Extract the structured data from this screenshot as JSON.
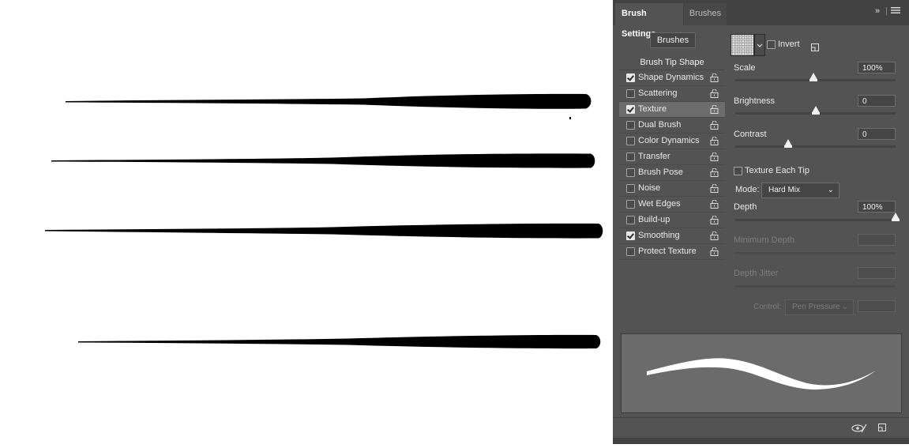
{
  "panel": {
    "tabs": [
      "Brush Settings",
      "Brushes"
    ],
    "brushes_button": "Brushes",
    "list_title": "Brush Tip Shape",
    "options": [
      {
        "label": "Shape Dynamics",
        "checked": true
      },
      {
        "label": "Scattering",
        "checked": false
      },
      {
        "label": "Texture",
        "checked": true,
        "selected": true
      },
      {
        "label": "Dual Brush",
        "checked": false
      },
      {
        "label": "Color Dynamics",
        "checked": false
      },
      {
        "label": "Transfer",
        "checked": false
      },
      {
        "label": "Brush Pose",
        "checked": false
      },
      {
        "label": "Noise",
        "checked": false
      },
      {
        "label": "Wet Edges",
        "checked": false
      },
      {
        "label": "Build-up",
        "checked": false
      },
      {
        "label": "Smoothing",
        "checked": true
      },
      {
        "label": "Protect Texture",
        "checked": false
      }
    ],
    "texture": {
      "invert_label": "Invert",
      "invert_checked": false,
      "scale_label": "Scale",
      "scale_value": "100%",
      "scale_level": 0.49,
      "brightness_label": "Brightness",
      "brightness_value": "0",
      "brightness_level": 0.5,
      "contrast_label": "Contrast",
      "contrast_value": "0",
      "contrast_level": 0.33,
      "texture_each_tip_label": "Texture Each Tip",
      "texture_each_tip_checked": false,
      "mode_label": "Mode:",
      "mode_value": "Hard Mix",
      "depth_label": "Depth",
      "depth_value": "100%",
      "depth_level": 1.0,
      "min_depth_label": "Minimum Depth",
      "depth_jitter_label": "Depth Jitter",
      "control_label": "Control:",
      "control_value": "Pen Pressure"
    },
    "icons": [
      "collapse-arrows-icon",
      "panel-menu-icon",
      "lock-icon",
      "new-preset-icon",
      "eye-crossed-icon",
      "create-new-brush-icon"
    ],
    "colors": {
      "panel_bg": "#535353",
      "tab_bar": "#424242",
      "selected_row": "#6c6c6c"
    }
  }
}
